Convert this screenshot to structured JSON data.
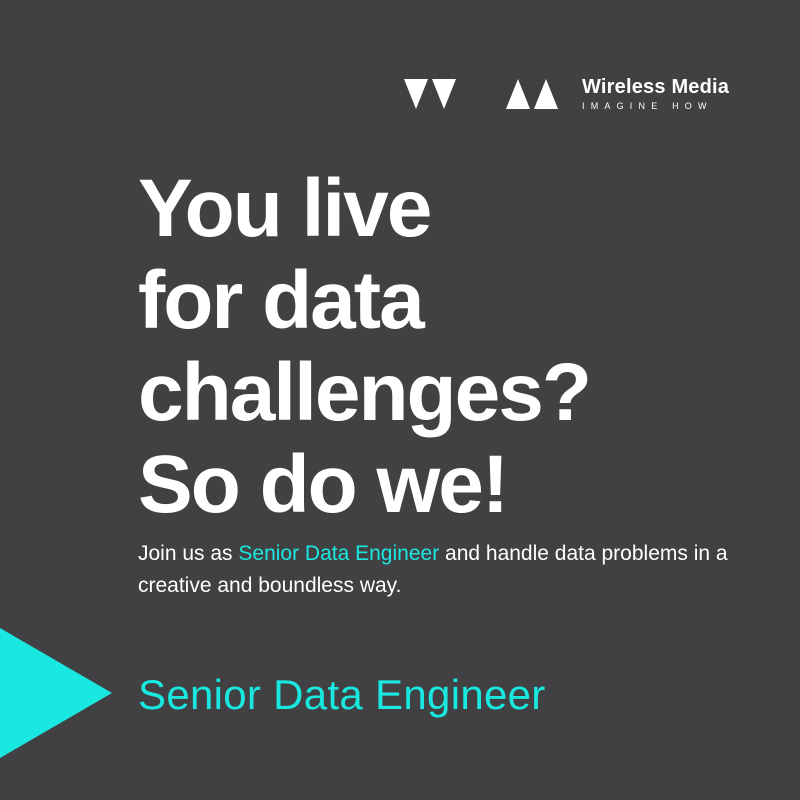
{
  "brand": {
    "name": "Wireless Media",
    "tagline": "IMAGINE HOW",
    "logo_icon": "wireless-media-triangles-logo"
  },
  "headline": {
    "lines": [
      "You live",
      "for data",
      "challenges?",
      "So do we!"
    ]
  },
  "body": {
    "prefix": "Join us as ",
    "highlight": "Senior Data Engineer",
    "suffix": " and handle data problems in a creative and boundless way."
  },
  "job_title": "Senior Data Engineer",
  "decoration": {
    "arrow_icon": "play-triangle-icon"
  },
  "colors": {
    "background": "#414143",
    "text": "#ffffff",
    "accent": "#19e8e0"
  }
}
